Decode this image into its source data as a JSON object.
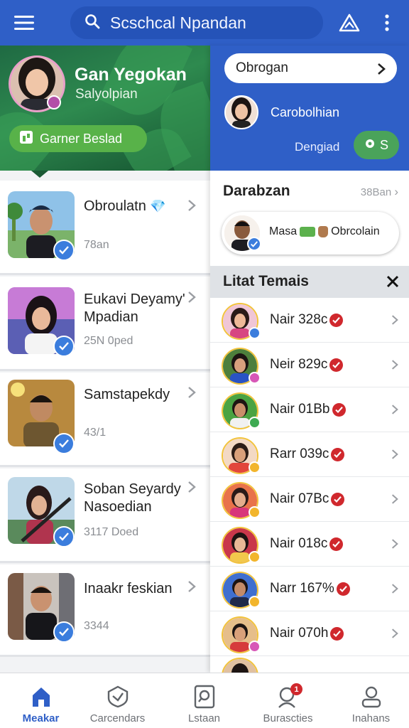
{
  "topbar": {
    "search_text": "Scschcal Npandan",
    "icons": [
      "hamburger-menu-icon",
      "search-icon",
      "warning-triangle-icon",
      "more-vertical-icon"
    ]
  },
  "profile": {
    "name": "Gan Yegokan",
    "subtitle": "Salyolpian",
    "button_label": "Garner Beslad"
  },
  "cards": [
    {
      "title": "Obroulatn",
      "sub": "78an"
    },
    {
      "title": "Eukavi Deyamy' Mpadian",
      "sub": "25N 0ped"
    },
    {
      "title": "Samstapekdy",
      "sub": "43/1"
    },
    {
      "title": "Soban Seyardy Nasoedian",
      "sub": "3117 Doed"
    },
    {
      "title": "Inaakr feskian",
      "sub": "3344"
    }
  ],
  "right_header": {
    "dropdown_label": "Obrogan",
    "user_name": "Carobolhian",
    "status_label": "Dengiad",
    "action_label": "S"
  },
  "section": {
    "title": "Darabzan",
    "count": "38Ban",
    "chat_preview": {
      "name": "Masa",
      "text": "Obrcolain"
    }
  },
  "list": {
    "title": "Litat Temais",
    "rows": [
      {
        "label": "Nair 328c"
      },
      {
        "label": "Neir 829c"
      },
      {
        "label": "Nair 01Bb"
      },
      {
        "label": "Rarr 039c"
      },
      {
        "label": "Nair 07Bc"
      },
      {
        "label": "Nair 018c"
      },
      {
        "label": "Narr 167%"
      },
      {
        "label": "Nair 070h"
      }
    ]
  },
  "bottom_nav": [
    {
      "label": "Meakar",
      "icon": "home-icon",
      "active": true
    },
    {
      "label": "Carcendars",
      "icon": "shield-check-icon",
      "active": false
    },
    {
      "label": "Lstaan",
      "icon": "search-document-icon",
      "active": false
    },
    {
      "label": "Burascties",
      "icon": "user-notification-icon",
      "active": false,
      "badge": "1"
    },
    {
      "label": "Inahans",
      "icon": "profile-icon",
      "active": false
    }
  ],
  "colors": {
    "primary": "#2f5fc7",
    "accent_green": "#58b249",
    "verify_blue": "#3b7ddd",
    "badge_red": "#d0282d"
  }
}
